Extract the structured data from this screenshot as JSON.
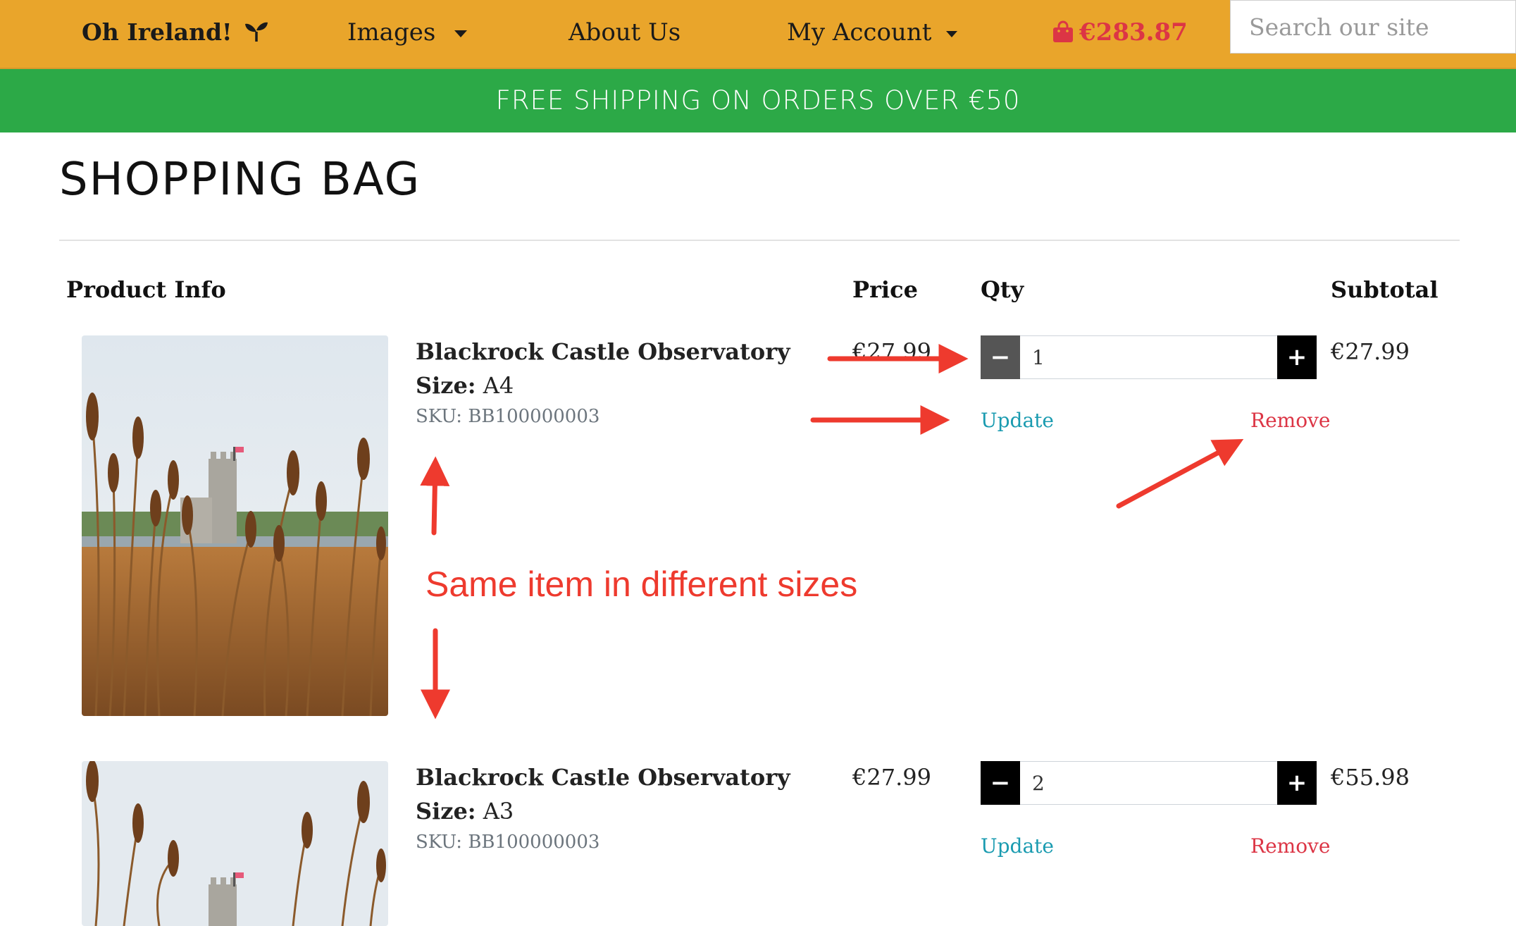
{
  "nav": {
    "brand": "Oh Ireland!",
    "images_label": "Images",
    "about_label": "About Us",
    "account_label": "My Account",
    "bag_total": "€283.87",
    "search_placeholder": "Search our site"
  },
  "banner": {
    "text": "FREE SHIPPING ON ORDERS OVER €50"
  },
  "page": {
    "title": "SHOPPING BAG"
  },
  "table": {
    "headers": {
      "product": "Product Info",
      "price": "Price",
      "qty": "Qty",
      "subtotal": "Subtotal"
    }
  },
  "items": [
    {
      "name": "Blackrock Castle Observatory",
      "size_label": "Size:",
      "size": "A4",
      "sku": "SKU: BB100000003",
      "price": "€27.99",
      "qty": "1",
      "subtotal": "€27.99",
      "update_label": "Update",
      "remove_label": "Remove"
    },
    {
      "name": "Blackrock Castle Observatory",
      "size_label": "Size:",
      "size": "A3",
      "sku": "SKU: BB100000003",
      "price": "€27.99",
      "qty": "2",
      "subtotal": "€55.98",
      "update_label": "Update",
      "remove_label": "Remove"
    }
  ],
  "annotation": {
    "text": "Same item in different sizes"
  },
  "colors": {
    "nav_bg": "#e9a52b",
    "banner_bg": "#2ca947",
    "bag_red": "#dc3545",
    "link_teal": "#1a9bb0",
    "annotation_red": "#ee3a2e"
  }
}
